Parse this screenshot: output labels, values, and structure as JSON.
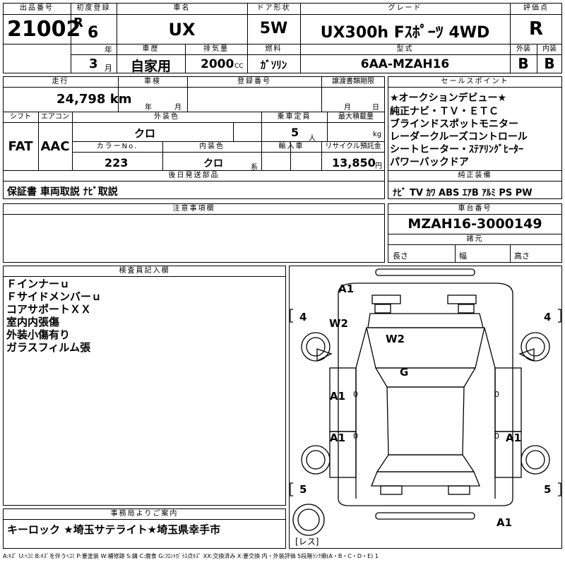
{
  "header": {
    "lot_no_label": "出品番号",
    "lot_no": "21002",
    "first_reg_label": "初度登録",
    "era": "R",
    "year": "6",
    "year_unit": "年",
    "month": "3",
    "month_unit": "月",
    "name_label": "車名",
    "name": "UX",
    "door_label": "ドア形状",
    "door": "5W",
    "grade_label": "グレード",
    "grade": "UX300h Fｽﾎﾟｰﾂ 4WD",
    "score_label": "評価点",
    "score": "R",
    "history_label": "車歴",
    "history": "自家用",
    "displacement_label": "排気量",
    "displacement": "2000",
    "cc": "CC",
    "fuel_label": "燃料",
    "fuel": "ｶﾞｿﾘﾝ",
    "model_label": "型式",
    "model": "6AA-MZAH16",
    "ext_label": "外装",
    "ext": "B",
    "int_label": "内装",
    "int": "B"
  },
  "row2": {
    "mileage_label": "走行",
    "mileage": "24,798 km",
    "inspection_label": "車検",
    "insp_year_unit": "年",
    "insp_month_unit": "月",
    "reg_label": "登録番号",
    "transfer_label": "譲渡書類期限",
    "transfer_month_unit": "月",
    "transfer_day_unit": "日",
    "shift_label": "シフト",
    "shift": "FAT",
    "ac_label": "エアコン",
    "ac": "AAC",
    "ext_color_label": "外装色",
    "ext_color": "クロ",
    "capacity_label": "乗車定員",
    "capacity": "5",
    "capacity_unit": "人",
    "load_label": "最大積載量",
    "load_unit": "kg",
    "color_no_label": "カラーNo.",
    "color_no": "223",
    "int_color_label": "内装色",
    "int_color": "クロ",
    "int_color_unit": "系",
    "import_label": "輸入車",
    "recycle_label": "リサイクル預託金",
    "recycle": "13,850",
    "recycle_unit": "円",
    "later_label": "後日発送部品",
    "later": "保証書 車両取説 ﾅﾋﾞ取説"
  },
  "sales_points": {
    "label": "セールスポイント",
    "items": [
      "★オークションデビュー★",
      "純正ナビ・ＴＶ・ＥＴＣ",
      "ブラインドスポットモニター",
      "レーダークルーズコントロール",
      "シートヒーター・ｽﾃｱﾘﾝｸﾞﾋｰﾀｰ",
      "パワーバックドア"
    ]
  },
  "equipment": {
    "label": "純正装備",
    "items": "ﾅﾋﾞ TV ｶﾜ ABS ｴｱB ｱﾙﾐ PS PW"
  },
  "notes": {
    "label": "注意事項欄"
  },
  "chassis": {
    "label": "車台番号",
    "number": "MZAH16-3000149",
    "spec_label": "諸元",
    "length_label": "長さ",
    "width_label": "幅",
    "height_label": "高さ"
  },
  "inspector": {
    "label": "検査員記入欄",
    "lines": [
      "Ｆインナーｕ",
      "Ｆサイドメンバーｕ",
      "コアサポートＸＸ",
      "室内内張傷",
      "外装小傷有り",
      "ガラスフィルム張"
    ]
  },
  "office": {
    "label": "事務局よりご案内",
    "text": "キーロック ★埼玉サテライト★埼玉県幸手市"
  },
  "diagram": {
    "bumper_front": "A1",
    "tl_num": "4",
    "tr_num": "4",
    "bl_num": "5",
    "br_num": "5",
    "fender_left": "W2",
    "hood": "W2",
    "roof": "G",
    "front_door_left": "A1",
    "rear_door_left": "A1",
    "rear_door_right": "A1",
    "bumper_rear": "A1",
    "spare_label": "レス",
    "mark_lf": "0",
    "mark_lr": "0",
    "mark_rf": "0",
    "mark_rr": "0"
  },
  "legend": "A:ｷｽﾞ U:ﾍｺﾐ B:ｷｽﾞを伴うﾍｺﾐ P:要塗装 W:補修跡 S:錆 C:腐食 G:ﾌﾛﾝﾄｶﾞﾗｽ点ｷｽﾞ XX:交換済み X:要交換 内・外装評価 5段階ﾗﾝｸ順(A・B・C・D・E) 1"
}
